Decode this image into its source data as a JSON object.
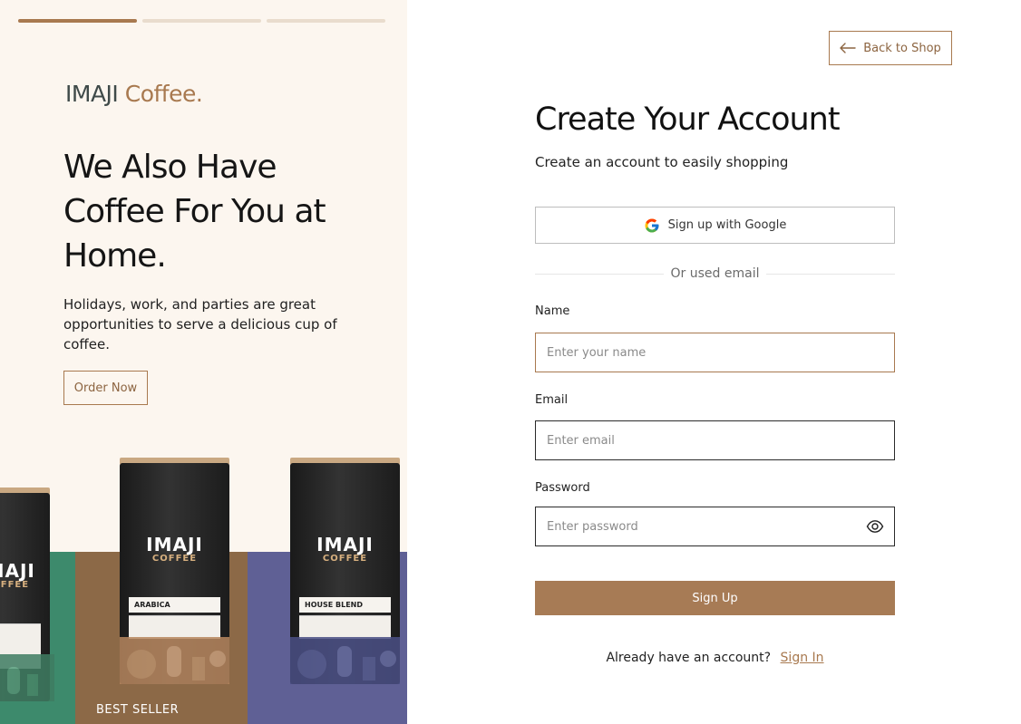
{
  "brand": {
    "name": "IMAJI",
    "suffix": "Coffee."
  },
  "hero": {
    "headline": "We Also Have Coffee For You at Home.",
    "description": "Holidays, work, and parties are great opportunities to serve a delicious cup of coffee.",
    "cta_label": "Order Now"
  },
  "carousel": {
    "active_index": 0,
    "segments": 3,
    "badge": "BEST SELLER",
    "products": [
      {
        "brand": "IMAJI",
        "sub": "COFFEE",
        "label": "ARABICA"
      },
      {
        "brand": "IMAJI",
        "sub": "COFFEE",
        "label": "HOUSE BLEND"
      }
    ]
  },
  "header": {
    "back_label": "Back to Shop"
  },
  "form": {
    "title": "Create Your Account",
    "subtitle": "Create an account to easily shopping",
    "google_label": "Sign up with Google",
    "divider_text": "Or used email",
    "name": {
      "label": "Name",
      "placeholder": "Enter your name",
      "value": ""
    },
    "email": {
      "label": "Email",
      "placeholder": "Enter email",
      "value": ""
    },
    "password": {
      "label": "Password",
      "placeholder": "Enter password",
      "value": ""
    },
    "submit_label": "Sign Up",
    "signin_prompt": "Already have an account?",
    "signin_link": "Sign In"
  },
  "colors": {
    "accent": "#a8794f",
    "button": "#a77b55",
    "panel_bg": "#fcf6ef",
    "green": "#3d8a6c",
    "brown": "#8c6947",
    "purple": "#5f6095"
  }
}
